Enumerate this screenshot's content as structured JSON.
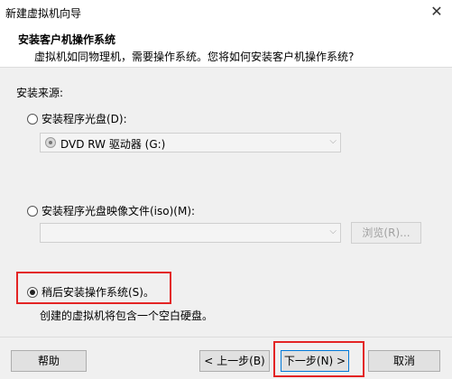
{
  "window": {
    "title": "新建虚拟机向导",
    "close_glyph": "✕"
  },
  "header": {
    "title": "安装客户机操作系统",
    "subtitle": "虚拟机如同物理机，需要操作系统。您将如何安装客户机操作系统?"
  },
  "section_label": "安装来源:",
  "options": {
    "disc": {
      "label": "安装程序光盘(D):",
      "checked": false
    },
    "disc_drive": {
      "value": "DVD RW 驱动器 (G:)",
      "icon": "disc-drive-icon"
    },
    "iso": {
      "label": "安装程序光盘映像文件(iso)(M):",
      "checked": false
    },
    "iso_path": {
      "value": ""
    },
    "browse_label": "浏览(R)...",
    "later": {
      "label": "稍后安装操作系统(S)。",
      "checked": true
    },
    "later_note": "创建的虚拟机将包含一个空白硬盘。"
  },
  "footer": {
    "help": "帮助",
    "back": "< 上一步(B)",
    "next": "下一步(N) >",
    "cancel": "取消"
  },
  "colors": {
    "highlight_border": "#e32424",
    "default_button_border": "#0078d7"
  }
}
